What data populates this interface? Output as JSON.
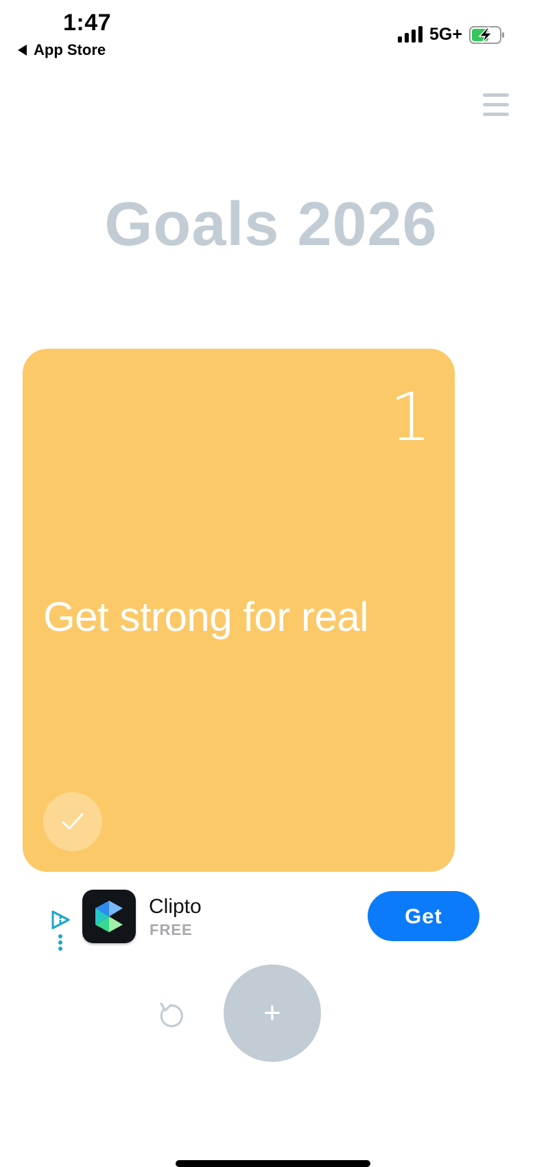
{
  "status_bar": {
    "time": "1:47",
    "back_label": "App Store",
    "network": "5G+",
    "battery": "charging"
  },
  "header": {
    "menu_icon": "hamburger-menu-icon",
    "title": "Goals 2026"
  },
  "goal_card": {
    "number": "1",
    "text": "Get strong for real",
    "color": "#fbc968",
    "check_icon": "checkmark-icon"
  },
  "ad": {
    "app_name": "Clipto",
    "price": "FREE",
    "cta": "Get",
    "cta_color": "#0b7bfa"
  },
  "controls": {
    "undo_icon": "undo-icon",
    "add_label": "+"
  },
  "colors": {
    "accent": "#c2ccd4"
  }
}
